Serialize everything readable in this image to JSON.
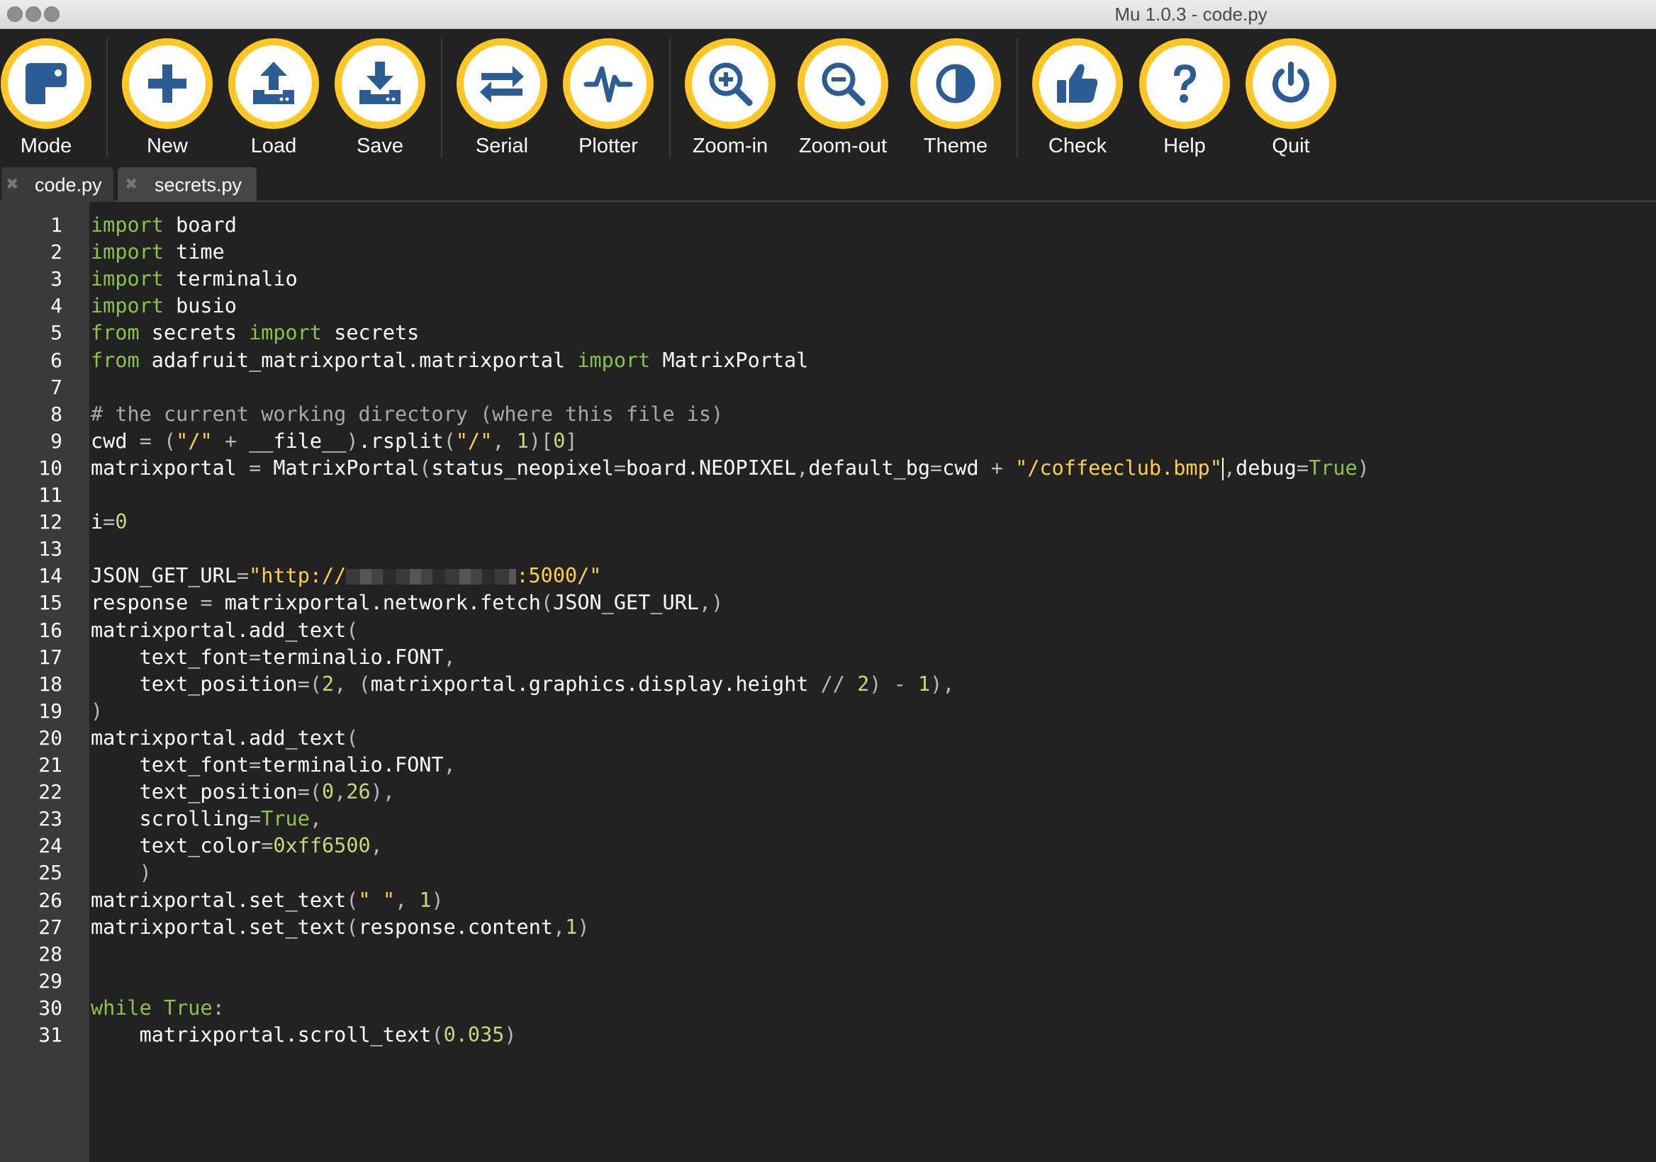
{
  "window": {
    "title": "Mu 1.0.3 - code.py"
  },
  "toolbar": {
    "buttons": [
      {
        "label": "Mode",
        "icon": "mode-icon"
      },
      {
        "label": "New",
        "icon": "plus-icon"
      },
      {
        "label": "Load",
        "icon": "upload-icon"
      },
      {
        "label": "Save",
        "icon": "download-icon"
      },
      {
        "label": "Serial",
        "icon": "arrows-exchange-icon"
      },
      {
        "label": "Plotter",
        "icon": "pulse-icon"
      },
      {
        "label": "Zoom-in",
        "icon": "zoom-in-icon"
      },
      {
        "label": "Zoom-out",
        "icon": "zoom-out-icon"
      },
      {
        "label": "Theme",
        "icon": "half-circle-icon"
      },
      {
        "label": "Check",
        "icon": "thumbs-up-icon"
      },
      {
        "label": "Help",
        "icon": "question-icon"
      },
      {
        "label": "Quit",
        "icon": "power-icon"
      }
    ],
    "accent_color": "#ffc726",
    "icon_color": "#2c5c94"
  },
  "tabs": [
    {
      "label": "code.py",
      "active": false
    },
    {
      "label": "secrets.py",
      "active": true
    }
  ],
  "editor": {
    "line_numbers": [
      "1",
      "2",
      "3",
      "4",
      "5",
      "6",
      "7",
      "8",
      "9",
      "10",
      "11",
      "12",
      "13",
      "14",
      "15",
      "16",
      "17",
      "18",
      "19",
      "20",
      "21",
      "22",
      "23",
      "24",
      "25",
      "26",
      "27",
      "28",
      "29",
      "30",
      "31"
    ],
    "lines": [
      [
        [
          "kw",
          "import"
        ],
        [
          "t",
          " board"
        ]
      ],
      [
        [
          "kw",
          "import"
        ],
        [
          "t",
          " time"
        ]
      ],
      [
        [
          "kw",
          "import"
        ],
        [
          "t",
          " terminalio"
        ]
      ],
      [
        [
          "kw",
          "import"
        ],
        [
          "t",
          " busio"
        ]
      ],
      [
        [
          "kw",
          "from"
        ],
        [
          "t",
          " secrets "
        ],
        [
          "kw",
          "import"
        ],
        [
          "t",
          " secrets"
        ]
      ],
      [
        [
          "kw",
          "from"
        ],
        [
          "t",
          " adafruit_matrixportal.matrixportal "
        ],
        [
          "kw",
          "import"
        ],
        [
          "t",
          " MatrixPortal"
        ]
      ],
      [],
      [
        [
          "cm",
          "# the current working directory (where this file is)"
        ]
      ],
      [
        [
          "t",
          "cwd "
        ],
        [
          "op",
          "="
        ],
        [
          "t",
          " "
        ],
        [
          "op",
          "("
        ],
        [
          "st",
          "\"/\""
        ],
        [
          "t",
          " "
        ],
        [
          "op",
          "+"
        ],
        [
          "t",
          " __file__"
        ],
        [
          "op",
          ")"
        ],
        [
          "t",
          ".rsplit"
        ],
        [
          "op",
          "("
        ],
        [
          "st",
          "\"/\""
        ],
        [
          "op",
          ","
        ],
        [
          "t",
          " "
        ],
        [
          "nu",
          "1"
        ],
        [
          "op",
          ")"
        ],
        [
          "op",
          "["
        ],
        [
          "nu",
          "0"
        ],
        [
          "op",
          "]"
        ]
      ],
      [
        [
          "t",
          "matrixportal "
        ],
        [
          "op",
          "="
        ],
        [
          "t",
          " MatrixPortal"
        ],
        [
          "op",
          "("
        ],
        [
          "t",
          "status_neopixel"
        ],
        [
          "op",
          "="
        ],
        [
          "t",
          "board.NEOPIXEL"
        ],
        [
          "op",
          ","
        ],
        [
          "t",
          "default_bg"
        ],
        [
          "op",
          "="
        ],
        [
          "t",
          "cwd "
        ],
        [
          "op",
          "+"
        ],
        [
          "t",
          " "
        ],
        [
          "st",
          "\"/coffeeclub.bmp\""
        ],
        [
          "cursor",
          ""
        ],
        [
          "op",
          ","
        ],
        [
          "t",
          "debug"
        ],
        [
          "op",
          "="
        ],
        [
          "kw",
          "True"
        ],
        [
          "op",
          ")"
        ]
      ],
      [],
      [
        [
          "t",
          "i"
        ],
        [
          "op",
          "="
        ],
        [
          "nu",
          "0"
        ]
      ],
      [],
      [
        [
          "t",
          "JSON_GET_URL"
        ],
        [
          "op",
          "="
        ],
        [
          "st",
          "\"http://"
        ],
        [
          "pix",
          ""
        ],
        [
          "st",
          ":5000/\""
        ]
      ],
      [
        [
          "t",
          "response "
        ],
        [
          "op",
          "="
        ],
        [
          "t",
          " matrixportal.network.fetch"
        ],
        [
          "op",
          "("
        ],
        [
          "t",
          "JSON_GET_URL"
        ],
        [
          "op",
          ","
        ],
        [
          "op",
          ")"
        ]
      ],
      [
        [
          "t",
          "matrixportal.add_text"
        ],
        [
          "op",
          "("
        ]
      ],
      [
        [
          "t",
          "    text_font"
        ],
        [
          "op",
          "="
        ],
        [
          "t",
          "terminalio.FONT"
        ],
        [
          "op",
          ","
        ]
      ],
      [
        [
          "t",
          "    text_position"
        ],
        [
          "op",
          "="
        ],
        [
          "op",
          "("
        ],
        [
          "nu",
          "2"
        ],
        [
          "op",
          ","
        ],
        [
          "t",
          " "
        ],
        [
          "op",
          "("
        ],
        [
          "t",
          "matrixportal.graphics.display.height "
        ],
        [
          "op",
          "//"
        ],
        [
          "t",
          " "
        ],
        [
          "nu",
          "2"
        ],
        [
          "op",
          ")"
        ],
        [
          "t",
          " "
        ],
        [
          "op",
          "-"
        ],
        [
          "t",
          " "
        ],
        [
          "nu",
          "1"
        ],
        [
          "op",
          ")"
        ],
        [
          "op",
          ","
        ]
      ],
      [
        [
          "op",
          ")"
        ]
      ],
      [
        [
          "t",
          "matrixportal.add_text"
        ],
        [
          "op",
          "("
        ]
      ],
      [
        [
          "t",
          "    text_font"
        ],
        [
          "op",
          "="
        ],
        [
          "t",
          "terminalio.FONT"
        ],
        [
          "op",
          ","
        ]
      ],
      [
        [
          "t",
          "    text_position"
        ],
        [
          "op",
          "="
        ],
        [
          "op",
          "("
        ],
        [
          "nu",
          "0"
        ],
        [
          "op",
          ","
        ],
        [
          "nu",
          "26"
        ],
        [
          "op",
          ")"
        ],
        [
          "op",
          ","
        ]
      ],
      [
        [
          "t",
          "    scrolling"
        ],
        [
          "op",
          "="
        ],
        [
          "kw",
          "True"
        ],
        [
          "op",
          ","
        ]
      ],
      [
        [
          "t",
          "    text_color"
        ],
        [
          "op",
          "="
        ],
        [
          "nu",
          "0xff6500"
        ],
        [
          "op",
          ","
        ]
      ],
      [
        [
          "op",
          "    )"
        ]
      ],
      [
        [
          "t",
          "matrixportal.set_text"
        ],
        [
          "op",
          "("
        ],
        [
          "st",
          "\" \""
        ],
        [
          "op",
          ","
        ],
        [
          "t",
          " "
        ],
        [
          "nu",
          "1"
        ],
        [
          "op",
          ")"
        ]
      ],
      [
        [
          "t",
          "matrixportal.set_text"
        ],
        [
          "op",
          "("
        ],
        [
          "t",
          "response.content"
        ],
        [
          "op",
          ","
        ],
        [
          "nu",
          "1"
        ],
        [
          "op",
          ")"
        ]
      ],
      [],
      [],
      [
        [
          "kw",
          "while"
        ],
        [
          "t",
          " "
        ],
        [
          "kw",
          "True"
        ],
        [
          "op",
          ":"
        ]
      ],
      [
        [
          "t",
          "    matrixportal.scroll_text"
        ],
        [
          "op",
          "("
        ],
        [
          "nu",
          "0.035"
        ],
        [
          "op",
          ")"
        ]
      ]
    ]
  }
}
